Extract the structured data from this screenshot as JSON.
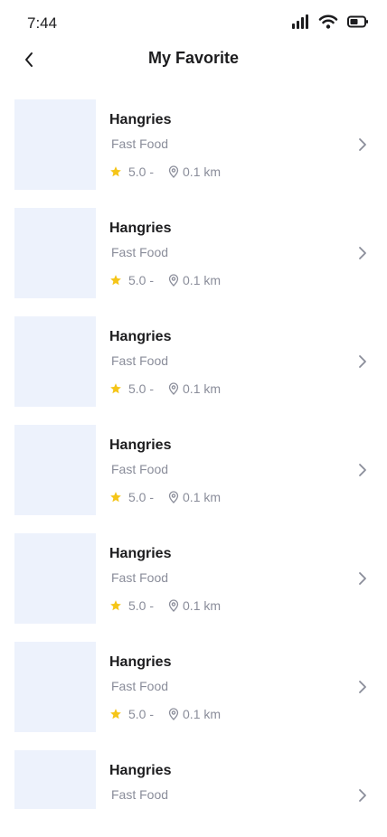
{
  "status_bar": {
    "time": "7:44",
    "icons": [
      "signal-icon",
      "wifi-icon",
      "battery-icon"
    ]
  },
  "header": {
    "title": "My Favorite",
    "back_icon": "chevron-left-icon"
  },
  "favorites": [
    {
      "name": "Hangries",
      "category": "Fast Food",
      "rating": "5.0 -",
      "distance": "0.1 km"
    },
    {
      "name": "Hangries",
      "category": "Fast Food",
      "rating": "5.0 -",
      "distance": "0.1 km"
    },
    {
      "name": "Hangries",
      "category": "Fast Food",
      "rating": "5.0 -",
      "distance": "0.1 km"
    },
    {
      "name": "Hangries",
      "category": "Fast Food",
      "rating": "5.0 -",
      "distance": "0.1 km"
    },
    {
      "name": "Hangries",
      "category": "Fast Food",
      "rating": "5.0 -",
      "distance": "0.1 km"
    },
    {
      "name": "Hangries",
      "category": "Fast Food",
      "rating": "5.0 -",
      "distance": "0.1 km"
    },
    {
      "name": "Hangries",
      "category": "Fast Food"
    }
  ],
  "colors": {
    "thumbnail_placeholder": "#edf2fc",
    "star": "#f5c518",
    "secondary_text": "#8a8d9a"
  }
}
